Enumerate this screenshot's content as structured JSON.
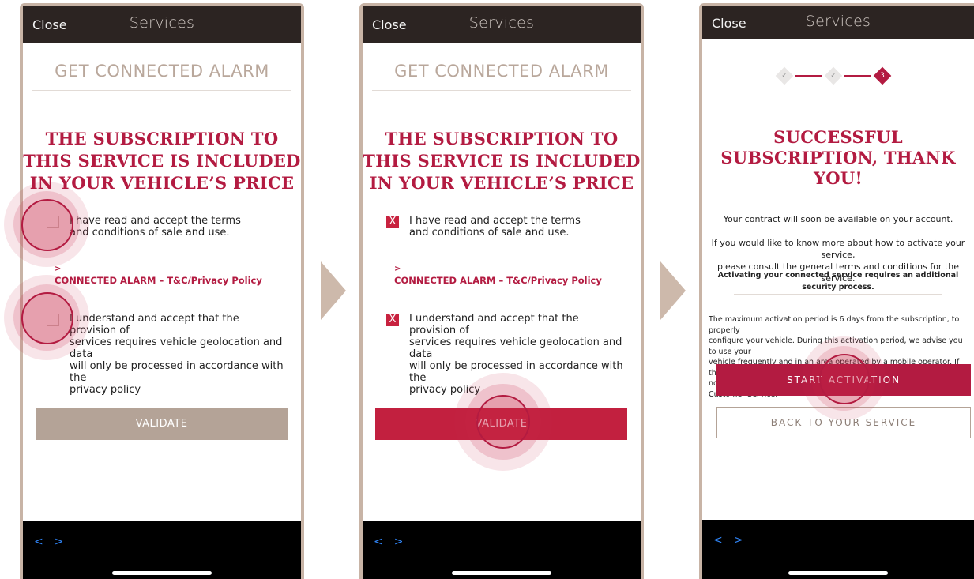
{
  "colors": {
    "brand": "#b31b41",
    "topbar": "#2c2422",
    "taupe": "#b4a397",
    "frame": "#c8b4a6"
  },
  "screens": [
    {
      "close_label": "Close",
      "title": "Services",
      "service_title": "GET CONNECTED ALARM",
      "headline": [
        "THE SUBSCRIPTION TO",
        "THIS SERVICE IS INCLUDED",
        "IN YOUR VEHICLE’S PRICE"
      ],
      "terms_lines": [
        "I have read and accept the terms",
        "and conditions of sale and use."
      ],
      "terms_checked": false,
      "policy_arrow": ">",
      "policy_link": "CONNECTED ALARM – T&C/Privacy Policy",
      "geo_lines": [
        "I understand and accept that the provision of",
        "services requires vehicle geolocation and data",
        "will only be processed in accordance with the",
        "privacy policy"
      ],
      "geo_checked": false,
      "validate_label": "VALIDATE",
      "validate_enabled": false,
      "nav_back": "<",
      "nav_forward": ">"
    },
    {
      "close_label": "Close",
      "title": "Services",
      "service_title": "GET CONNECTED ALARM",
      "headline": [
        "THE SUBSCRIPTION TO",
        "THIS SERVICE IS INCLUDED",
        "IN YOUR VEHICLE’S PRICE"
      ],
      "terms_lines": [
        "I have read and accept the terms",
        "and conditions of sale and use."
      ],
      "terms_checked": true,
      "check_mark": "X",
      "policy_arrow": ">",
      "policy_link": "CONNECTED ALARM – T&C/Privacy Policy",
      "geo_lines": [
        "I understand and accept that the provision of",
        "services requires vehicle geolocation and data",
        "will only be processed in accordance with the",
        "privacy policy"
      ],
      "geo_checked": true,
      "validate_label": "VALIDATE",
      "validate_enabled": true,
      "nav_back": "<",
      "nav_forward": ">"
    },
    {
      "close_label": "Close",
      "title": "Services",
      "steps": [
        {
          "label": "✓",
          "state": "done"
        },
        {
          "label": "✓",
          "state": "done"
        },
        {
          "label": "3",
          "state": "active"
        }
      ],
      "headline": [
        "SUCCESSFUL",
        "SUBSCRIPTION, THANK",
        "YOU!"
      ],
      "contract_text": "Your contract will soon be available on your account.",
      "info_lines": [
        "If you would like to know more about how to activate your service,",
        "please consult the general terms and conditions for the service."
      ],
      "security_text": "Activating your connected service requires an additional security process.",
      "period_lines": [
        "The maximum activation period is 6 days from the subscription, to properly",
        "configure your vehicle. During this activation period, we advise you to use your",
        "vehicle frequently and in an area operated by a mobile operator. If the service has",
        "not been activated at the end of this period, please contact our Customer Service."
      ],
      "start_label": "START ACTIVATION",
      "back_label": "BACK TO YOUR SERVICE",
      "nav_back": "<",
      "nav_forward": ">"
    }
  ]
}
